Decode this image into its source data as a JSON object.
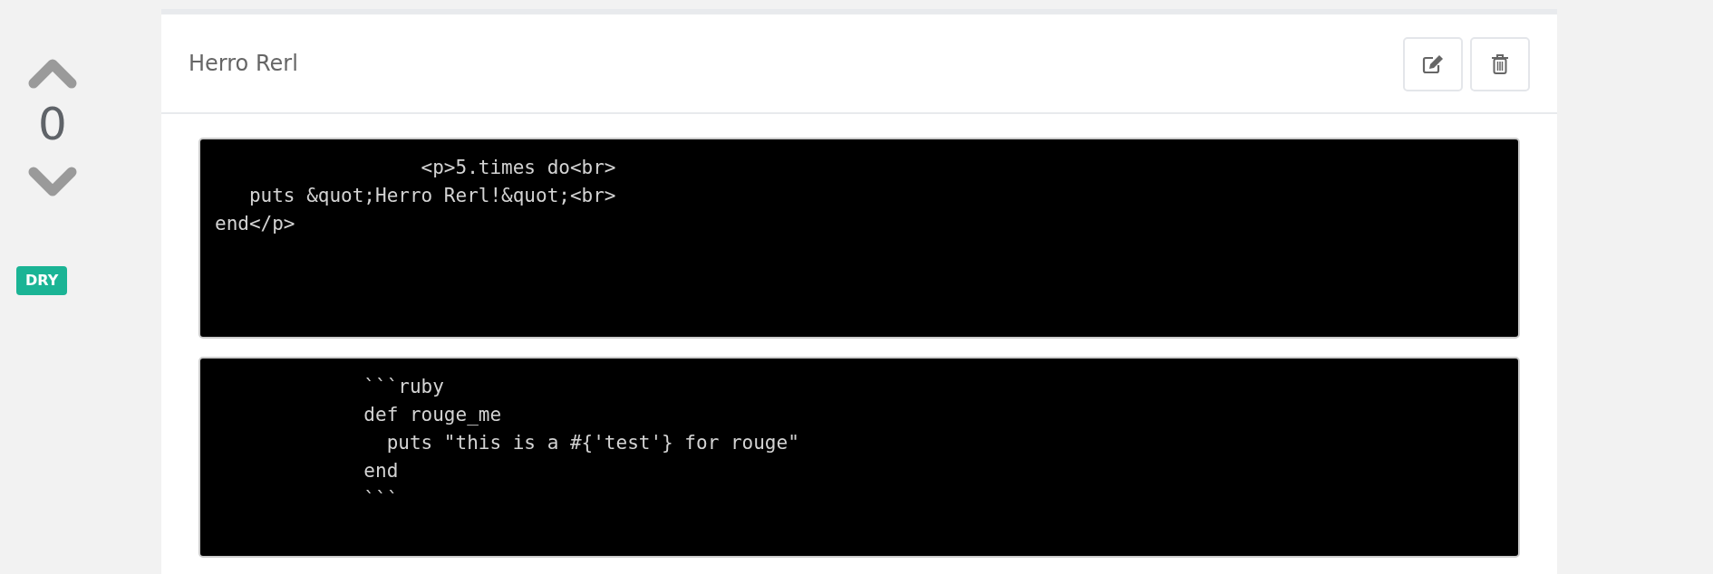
{
  "vote": {
    "score": "0"
  },
  "tag": {
    "label": "DRY"
  },
  "post": {
    "title": "Herro Rerl",
    "code_blocks": [
      {
        "text": "                  <p>5.times do<br>\n   puts &quot;Herro Rerl!&quot;<br>\nend</p>"
      },
      {
        "text": "             ```ruby\n             def rouge_me\n               puts \"this is a #{'test'} for rouge\"\n             end\n             ```"
      }
    ]
  }
}
